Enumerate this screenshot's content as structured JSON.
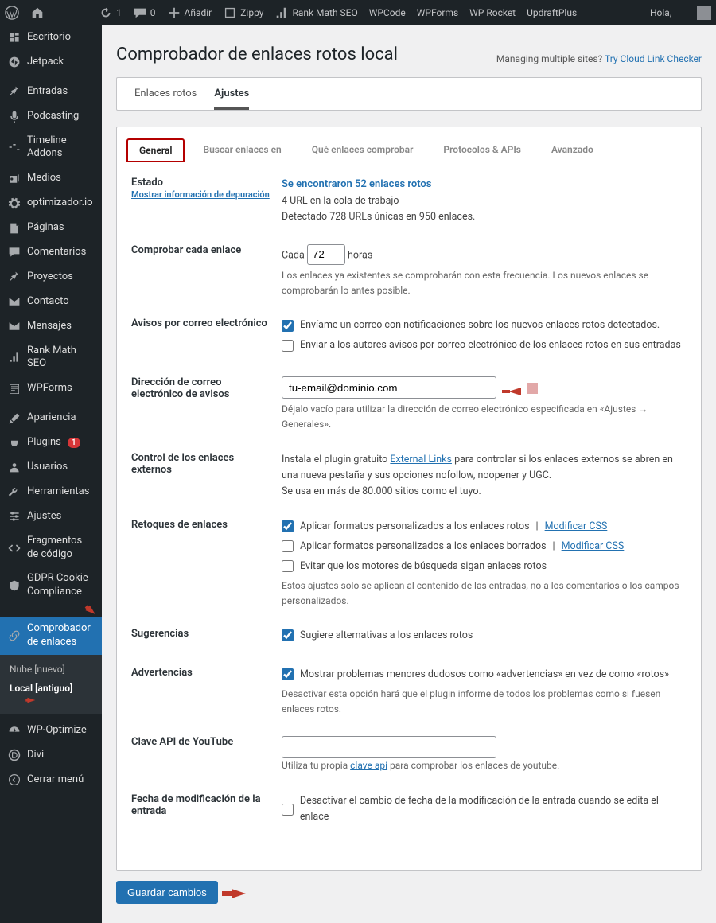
{
  "adminbar": {
    "refresh_count": "1",
    "comments_count": "0",
    "add_new": "Añadir",
    "items": [
      "Zippy",
      "Rank Math SEO",
      "WPCode",
      "WPForms",
      "WP Rocket",
      "UpdraftPlus"
    ],
    "greeting": "Hola,"
  },
  "sidebar": {
    "items": [
      {
        "label": "Escritorio",
        "icon": "dashboard"
      },
      {
        "label": "Jetpack",
        "icon": "jetpack"
      },
      {
        "label": "Entradas",
        "icon": "pin"
      },
      {
        "label": "Podcasting",
        "icon": "mic"
      },
      {
        "label": "Timeline Addons",
        "icon": "timeline"
      },
      {
        "label": "Medios",
        "icon": "media"
      },
      {
        "label": "optimizador.io",
        "icon": "gear"
      },
      {
        "label": "Páginas",
        "icon": "page"
      },
      {
        "label": "Comentarios",
        "icon": "comment"
      },
      {
        "label": "Proyectos",
        "icon": "pin"
      },
      {
        "label": "Contacto",
        "icon": "mail"
      },
      {
        "label": "Mensajes",
        "icon": "mail"
      },
      {
        "label": "Rank Math SEO",
        "icon": "chart"
      },
      {
        "label": "WPForms",
        "icon": "wpf"
      },
      {
        "label": "Apariencia",
        "icon": "brush"
      },
      {
        "label": "Plugins",
        "icon": "plug",
        "badge": "1"
      },
      {
        "label": "Usuarios",
        "icon": "user"
      },
      {
        "label": "Herramientas",
        "icon": "wrench"
      },
      {
        "label": "Ajustes",
        "icon": "sliders"
      },
      {
        "label": "Fragmentos de código",
        "icon": "code"
      },
      {
        "label": "GDPR Cookie Compliance",
        "icon": "shield"
      },
      {
        "label": "Comprobador de enlaces",
        "icon": "link",
        "active": true
      },
      {
        "label": "WP-Optimize",
        "icon": "speed"
      },
      {
        "label": "Divi",
        "icon": "divi"
      },
      {
        "label": "Cerrar menú",
        "icon": "collapse"
      }
    ],
    "submenu": {
      "items": [
        "Nube [nuevo]",
        "Local [antiguo]"
      ],
      "active": "Local [antiguo]"
    }
  },
  "header": {
    "title": "Comprobador de enlaces rotos local",
    "cloud_note": "Managing multiple sites?",
    "cloud_link": "Try Cloud Link Checker"
  },
  "top_tabs": [
    "Enlaces rotos",
    "Ajustes"
  ],
  "top_tab_active": "Ajustes",
  "sub_tabs": [
    "General",
    "Buscar enlaces en",
    "Qué enlaces comprobar",
    "Protocolos & APIs",
    "Avanzado"
  ],
  "sub_tab_active": "General",
  "form": {
    "status": {
      "label": "Estado",
      "debug": "Mostrar información de depuración",
      "result": "Se encontraron 52 enlaces rotos",
      "queue": "4 URL en la cola de trabajo",
      "detected": "Detectado 728 URLs únicas en 950 enlaces."
    },
    "check_every": {
      "label": "Comprobar cada enlace",
      "prefix": "Cada",
      "value": "72",
      "suffix": "horas",
      "desc": "Los enlaces ya existentes se comprobarán con esta frecuencia. Los nuevos enlaces se comprobarán lo antes posible."
    },
    "email": {
      "label": "Avisos por correo electrónico",
      "opt1": "Envíame un correo con notificaciones sobre los nuevos enlaces rotos detectados.",
      "opt2": "Enviar a los autores avisos por correo electrónico de los enlaces rotos en sus entradas"
    },
    "emailaddr": {
      "label": "Dirección de correo electrónico de avisos",
      "value": "tu-email@dominio.com",
      "desc": "Déjalo vacío para utilizar la dirección de correo electrónico especificada en «Ajustes → Generales»."
    },
    "external": {
      "label": "Control de los enlaces externos",
      "text1": "Instala el plugin gratuito ",
      "link": "External Links",
      "text2": " para controlar si los enlaces externos se abren en una nueva pestaña y sus opciones nofollow, noopener y UGC.",
      "text3": "Se usa en más de 80.000 sitios como el tuyo."
    },
    "tweaks": {
      "label": "Retoques de enlaces",
      "opt1": "Aplicar formatos personalizados a los enlaces rotos",
      "modify_css": "Modificar CSS",
      "opt2": "Aplicar formatos personalizados a los enlaces borrados",
      "opt3": "Evitar que los motores de búsqueda sigan enlaces rotos",
      "desc": "Estos ajustes solo se aplican al contenido de las entradas, no a los comentarios o los campos personalizados."
    },
    "suggestions": {
      "label": "Sugerencias",
      "opt1": "Sugiere alternativas a los enlaces rotos"
    },
    "warnings": {
      "label": "Advertencias",
      "opt1": "Mostrar problemas menores dudosos como «advertencias» en vez de como «rotos»",
      "desc": "Desactivar esta opción hará que el plugin informe de todos los problemas como si fuesen enlaces rotos."
    },
    "youtube": {
      "label": "Clave API de YouTube",
      "desc1": "Utiliza tu propia ",
      "link": "clave api",
      "desc2": " para comprobar los enlaces de youtube."
    },
    "moddate": {
      "label": "Fecha de modificación de la entrada",
      "opt1": "Desactivar el cambio de fecha de la modificación de la entrada cuando se edita el enlace"
    },
    "save": "Guardar cambios"
  }
}
